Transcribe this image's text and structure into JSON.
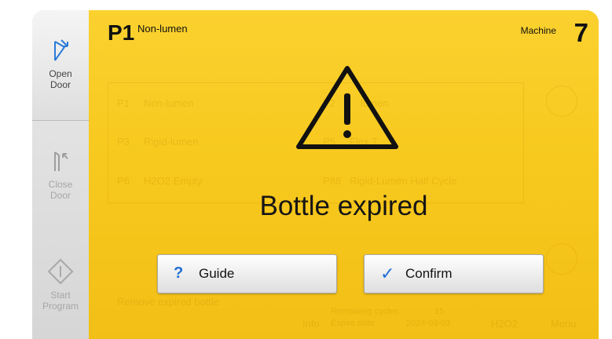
{
  "sidebar": {
    "open_door": {
      "line1": "Open",
      "line2": "Door"
    },
    "close_door": {
      "line1": "Close",
      "line2": "Door"
    },
    "start_program": {
      "line1": "Start",
      "line2": "Program"
    }
  },
  "header": {
    "program_code": "P1",
    "program_name": "Non-lumen",
    "machine_label": "Machine",
    "machine_number": "7"
  },
  "background": {
    "programs": [
      {
        "code": "P1",
        "name": "Non-lumen"
      },
      {
        "code": "P3",
        "name": "Rigid-lumen"
      },
      {
        "code": "P6",
        "name": "H2O2 Empty"
      },
      {
        "code": "P2",
        "name": "lumen"
      },
      {
        "code": "P5",
        "name": "Flex T"
      },
      {
        "code": "P88",
        "name": "Rigid-Lumen Half Cycle"
      }
    ],
    "status_text": "Remove expired bottle",
    "info_label": "Info",
    "remaining_label": "Remaining cycles",
    "remaining_value": "15",
    "expiry_label": "Expire date",
    "expiry_value": "2024-03-03",
    "h2o2_label": "H2O2",
    "menu_label": "Menu"
  },
  "dialog": {
    "message": "Bottle expired",
    "guide_label": "Guide",
    "confirm_label": "Confirm"
  },
  "colors": {
    "warning_bg": "#f7c91e",
    "accent_blue": "#1f6fd6"
  }
}
